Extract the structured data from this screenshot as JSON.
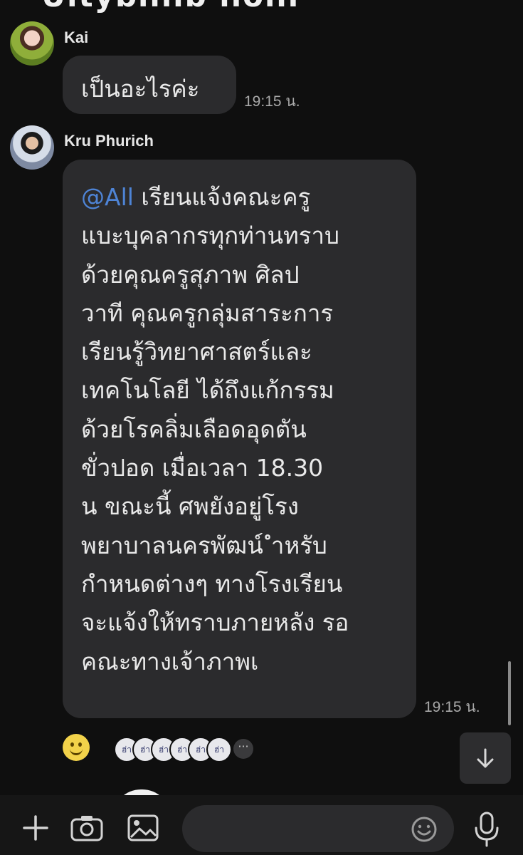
{
  "header": {
    "title_partial": "Ultyblllib   ilolii"
  },
  "messages": [
    {
      "sender": "Kai",
      "text": "เป็นอะไรค่ะ",
      "time": "19:15 น."
    },
    {
      "sender": "Kru Phurich",
      "mention": "@All",
      "lines": [
        " เรียนแจ้งคณะครู",
        "แบะบุคลากรทุกท่านทราบ",
        "ด้วยคุณครูสุภาพ ศิลป",
        "วาที คุณครูกลุ่มสาระการ",
        "เรียนรู้วิทยาศาสตร์และ",
        "เทคโนโลยี ได้ถึงแก้กรรม",
        "ด้วยโรคลิ่มเลือดอุดตัน",
        "ขั่วปอด เมื่อเวลา 18.30",
        "น ขณะนี้ ศพยังอยู่โรง",
        "พยาบาลนครพัฒน์ ำหรับ",
        "กำหนดต่างๆ ทางโรงเรียน",
        "จะแจ้งให้ทราบภายหลัง รอ",
        "คณะทางเจ้าภาพเ"
      ],
      "time": "19:15 น."
    }
  ],
  "reactions": {
    "readers": [
      "ฮ่า",
      "ฮ่า",
      "ฮ่า",
      "ฮ่า",
      "ฮ่า",
      "ฮ่า"
    ],
    "more": "···"
  },
  "composer": {
    "placeholder": ""
  },
  "icons": {
    "emoji": "smile-icon",
    "scroll_down": "arrow-down-icon",
    "add": "plus-icon",
    "camera": "camera-icon",
    "gallery": "image-icon",
    "sticker": "emoji-icon",
    "voice": "microphone-icon"
  },
  "colors": {
    "background": "#0f0f0f",
    "bubble": "#2b2b2d",
    "mention": "#4e84d6",
    "time": "#a9a9a9"
  }
}
